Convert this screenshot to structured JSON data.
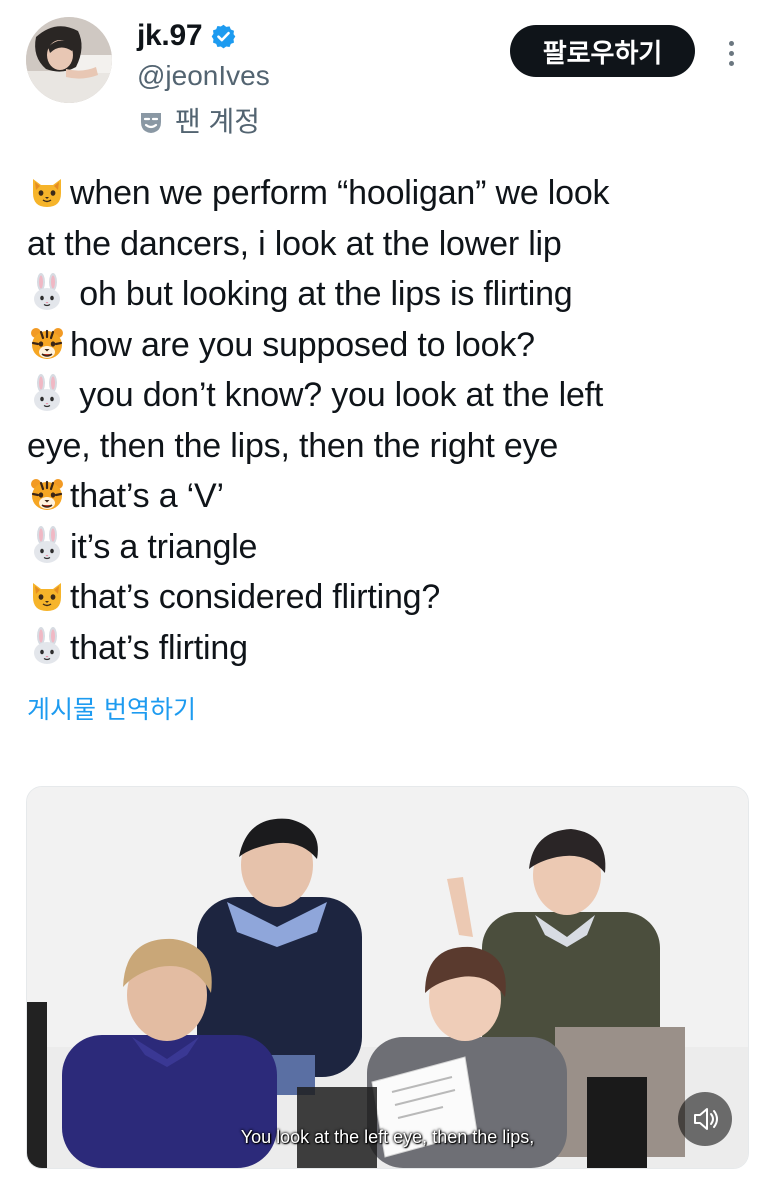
{
  "author": {
    "display_name": "jk.97",
    "handle": "@jeonIves",
    "verified": true,
    "badge_icon": "theater-mask-icon",
    "badge_label": "팬 계정"
  },
  "actions": {
    "follow_label": "팔로우하기",
    "more_icon": "more-vertical-icon"
  },
  "tweet": {
    "lines": [
      {
        "emoji": "cat-emoji",
        "text": "when we perform “hooligan” we look"
      },
      {
        "emoji": "",
        "text": "at the dancers, i look at the lower lip"
      },
      {
        "emoji": "rabbit-emoji",
        "text": " oh but looking at the lips is flirting"
      },
      {
        "emoji": "tiger-emoji",
        "text": "how are you supposed to look?"
      },
      {
        "emoji": "rabbit-emoji",
        "text": " you don’t know? you look at the left"
      },
      {
        "emoji": "",
        "text": "eye, then the lips, then the right eye"
      },
      {
        "emoji": "tiger-emoji",
        "text": "that’s a ‘V’"
      },
      {
        "emoji": "rabbit-emoji",
        "text": "it’s a triangle"
      },
      {
        "emoji": "cat-emoji",
        "text": "that’s considered flirting?"
      },
      {
        "emoji": "rabbit-emoji",
        "text": "that’s flirting"
      }
    ],
    "translate_label": "게시물 번역하기"
  },
  "media": {
    "caption": "You look at the left eye, then the lips,",
    "mute_icon": "speaker-icon"
  },
  "colors": {
    "text": "#0f1419",
    "secondary": "#536471",
    "link": "#1d9bf0",
    "follow_bg": "#0f1419",
    "verified": "#1d9bf0"
  }
}
